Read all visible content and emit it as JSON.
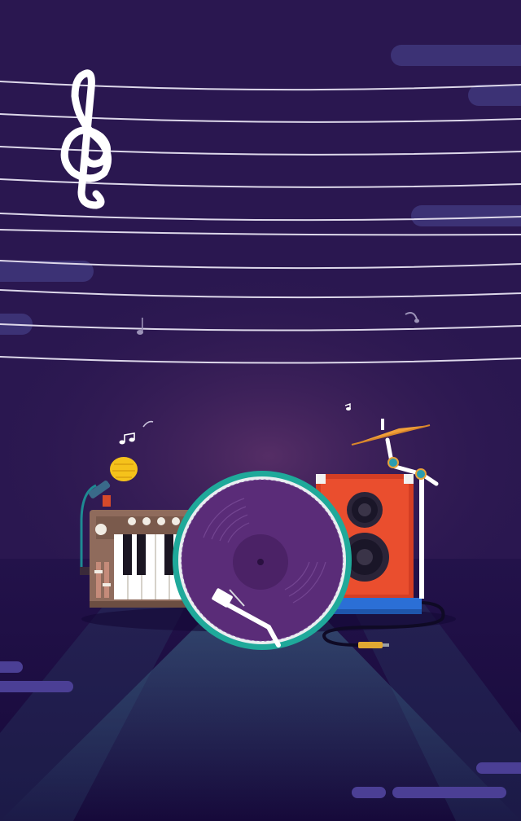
{
  "scene": {
    "description_icons": [
      "treble-clef-icon",
      "music-note-icon",
      "microphone-icon",
      "keyboard-icon",
      "vinyl-record-icon",
      "turntable-arm-icon",
      "speaker-icon",
      "cymbal-icon",
      "audio-cable-icon"
    ]
  },
  "colors": {
    "background_top": "#2a1750",
    "background_glow": "#4a2a60",
    "floor": "#1e0f45",
    "staff_line": "#e8e4f0",
    "pill": "#4a3f8f",
    "speaker_red": "#e8492d",
    "speaker_blue": "#2b6fd6",
    "record_teal": "#1fa99a",
    "record_purple": "#5a2c78",
    "keyboard_brown": "#8a6a5a",
    "cymbal_orange": "#f0a03a",
    "mic_yellow": "#f5c21b"
  }
}
